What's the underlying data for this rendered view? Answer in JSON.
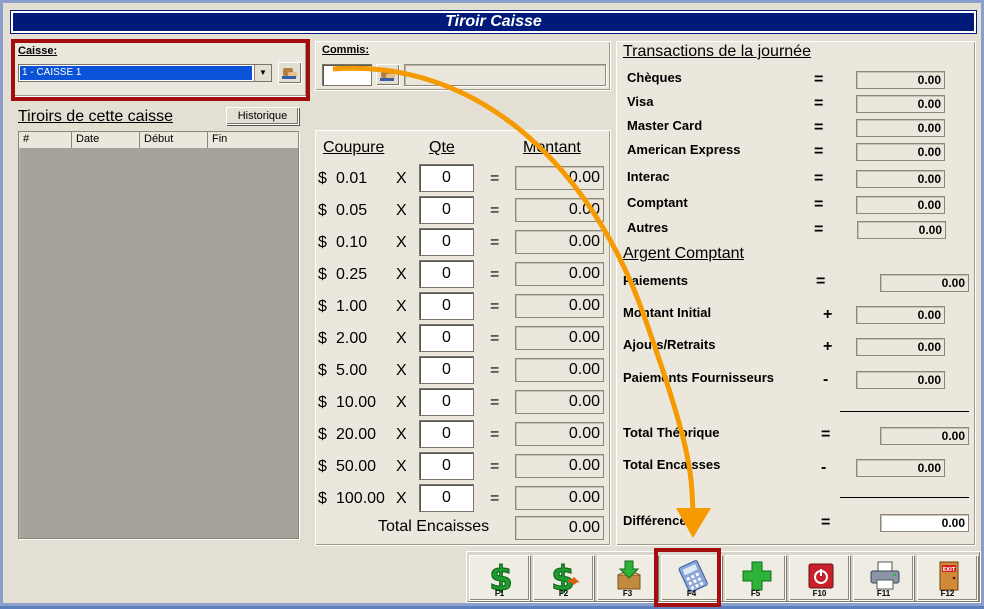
{
  "window": {
    "title": "Tiroir Caisse"
  },
  "caisse": {
    "label": "Caisse:",
    "selected": "1 - CAISSE 1"
  },
  "commis": {
    "label": "Commis:",
    "code": "",
    "name": ""
  },
  "tiroirs": {
    "title": "Tiroirs de cette caisse",
    "historique_label": "Historique",
    "columns": [
      "#",
      "Date",
      "Début",
      "Fin"
    ]
  },
  "denominations": {
    "headers": {
      "coupure": "Coupure",
      "qte": "Qte",
      "montant": "Montant"
    },
    "currency": "$",
    "times": "X",
    "equals": "=",
    "rows": [
      {
        "value": "0.01",
        "qty": "0",
        "amount": "0.00"
      },
      {
        "value": "0.05",
        "qty": "0",
        "amount": "0.00"
      },
      {
        "value": "0.10",
        "qty": "0",
        "amount": "0.00"
      },
      {
        "value": "0.25",
        "qty": "0",
        "amount": "0.00"
      },
      {
        "value": "1.00",
        "qty": "0",
        "amount": "0.00"
      },
      {
        "value": "2.00",
        "qty": "0",
        "amount": "0.00"
      },
      {
        "value": "5.00",
        "qty": "0",
        "amount": "0.00"
      },
      {
        "value": "10.00",
        "qty": "0",
        "amount": "0.00"
      },
      {
        "value": "20.00",
        "qty": "0",
        "amount": "0.00"
      },
      {
        "value": "50.00",
        "qty": "0",
        "amount": "0.00"
      },
      {
        "value": "100.00",
        "qty": "0",
        "amount": "0.00"
      }
    ],
    "total_label": "Total Encaisses",
    "total_value": "0.00"
  },
  "transactions": {
    "title": "Transactions de la journée",
    "rows": [
      {
        "label": "Chèques",
        "op": "=",
        "value": "0.00"
      },
      {
        "label": "Visa",
        "op": "=",
        "value": "0.00"
      },
      {
        "label": "Master Card",
        "op": "=",
        "value": "0.00"
      },
      {
        "label": "American Express",
        "op": "=",
        "value": "0.00"
      },
      {
        "label": "Interac",
        "op": "=",
        "value": "0.00"
      },
      {
        "label": "Comptant",
        "op": "=",
        "value": "0.00"
      },
      {
        "label": "Autres",
        "op": "=",
        "value": "0.00"
      }
    ]
  },
  "argent": {
    "title": "Argent Comptant",
    "paiements": {
      "label": "Paiements",
      "op": "=",
      "value": "0.00"
    },
    "montant_initial": {
      "label": "Montant Initial",
      "op": "+",
      "value": "0.00"
    },
    "ajouts": {
      "label": "Ajouts/Retraits",
      "op": "+",
      "value": "0.00"
    },
    "fournisseurs": {
      "label": "Paiements Fournisseurs",
      "op": "-",
      "value": "0.00"
    },
    "total_theorique": {
      "label": "Total Théorique",
      "op": "=",
      "value": "0.00"
    },
    "total_encaisses": {
      "label": "Total Encaisses",
      "op": "-",
      "value": "0.00"
    },
    "difference": {
      "label": "Différence",
      "op": "=",
      "value": "0.00"
    }
  },
  "toolbar": {
    "buttons": [
      {
        "key": "F1",
        "icon": "dollar-icon"
      },
      {
        "key": "F2",
        "icon": "dollar-transfer-icon"
      },
      {
        "key": "F3",
        "icon": "box-download-icon"
      },
      {
        "key": "F4",
        "icon": "calculator-icon"
      },
      {
        "key": "F5",
        "icon": "plus-icon"
      },
      {
        "key": "F10",
        "icon": "power-icon"
      },
      {
        "key": "F11",
        "icon": "printer-icon"
      },
      {
        "key": "F12",
        "icon": "exit-door-icon"
      }
    ],
    "exit_text": "EXIT"
  },
  "colors": {
    "title_bg": "#001a7a",
    "highlight": "#a30d0d",
    "arrow": "#f59a00",
    "selection": "#0a52d6"
  }
}
